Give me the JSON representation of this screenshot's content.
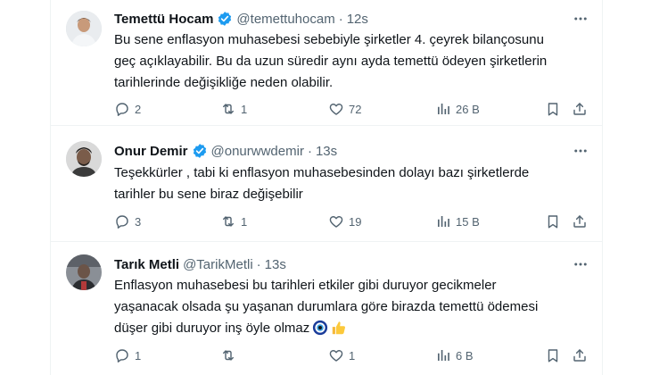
{
  "tweets": [
    {
      "name": "Temettü Hocam",
      "handle": "@temettuhocam",
      "dot": "·",
      "time": "12s",
      "text": "Bu sene enflasyon muhasebesi sebebiyle şirketler 4. çeyrek bilançosunu\ngeç açıklayabilir. Bu da uzun süredir aynı ayda temettü ödeyen şirketlerin\ntarihlerinde değişikliğe neden olabilir.",
      "replies": "2",
      "retweets": "1",
      "likes": "72",
      "views": "26 B",
      "verified": true
    },
    {
      "name": "Onur Demir",
      "handle": "@onurwwdemir",
      "dot": "·",
      "time": "13s",
      "text": "Teşekkürler , tabi ki enflasyon muhasebesinden dolayı bazı şirketlerde\ntarihler bu sene biraz değişebilir",
      "replies": "3",
      "retweets": "1",
      "likes": "19",
      "views": "15 B",
      "verified": true
    },
    {
      "name": "Tarık Metli",
      "handle": "@TarikMetli",
      "dot": "·",
      "time": "13s",
      "text": "Enflasyon muhasebesi bu tarihleri etkiler gibi duruyor gecikmeler\nyaşanacak olsada şu yaşanan durumlara göre birazda temettü ödemesi\ndüşer gibi duruyor inş öyle olmaz",
      "replies": "1",
      "retweets": "",
      "likes": "1",
      "views": "6 B",
      "verified": false
    }
  ],
  "colors": {
    "text": "#0f1419",
    "muted": "#536471",
    "verified": "#1d9bf0",
    "border": "#eff3f4"
  }
}
